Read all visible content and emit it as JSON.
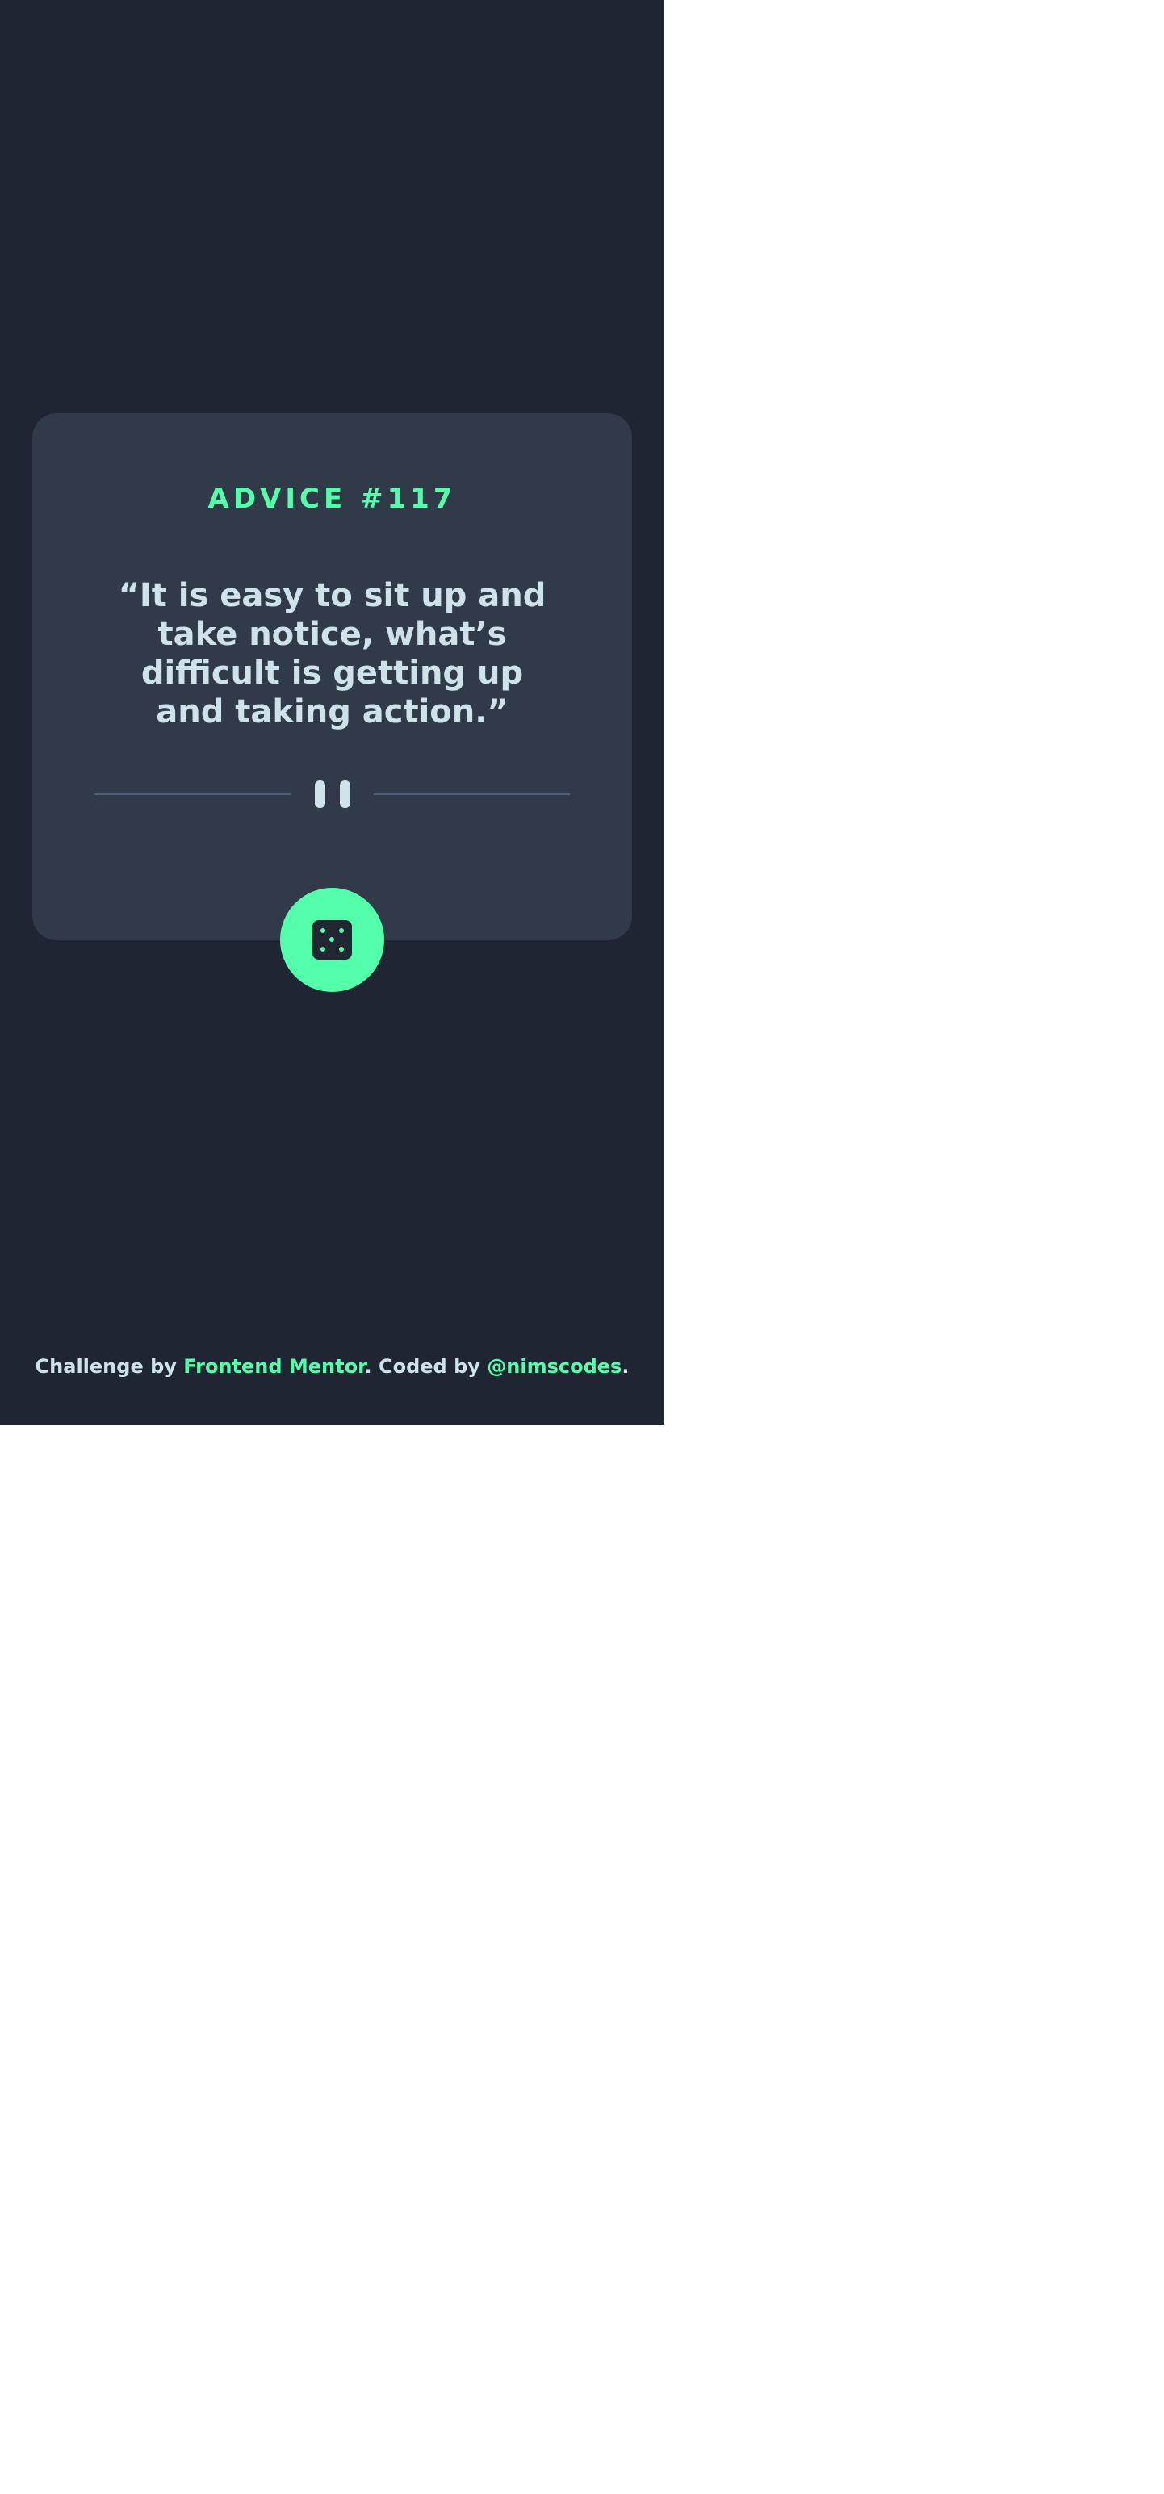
{
  "card": {
    "advice_id": "ADVICE #117",
    "advice_text": "“It is easy to sit up and take notice, what’s difficult is getting up and taking action.”"
  },
  "divider": {
    "icon": "pause-icon"
  },
  "dice_button": {
    "icon": "dice-icon"
  },
  "footer": {
    "prefix": "Challenge by ",
    "link1_label": "Frontend Mentor",
    "middle": ". Coded by ",
    "link2_label": "@nimscodes",
    "suffix": "."
  },
  "colors": {
    "background": "#1f2532",
    "card": "#313a49",
    "accent": "#53ffaa",
    "text": "#cee3e9",
    "divider": "#4f5d74"
  }
}
